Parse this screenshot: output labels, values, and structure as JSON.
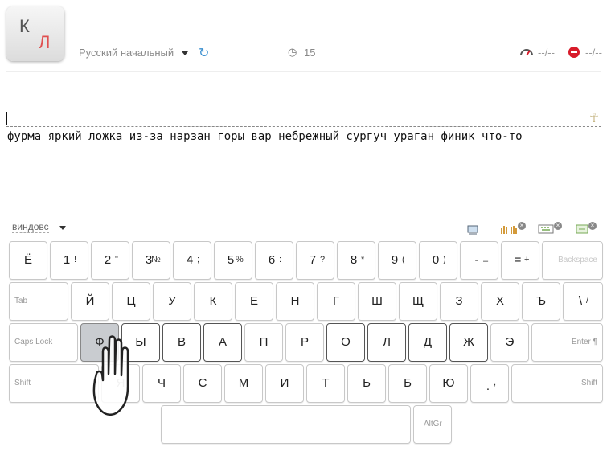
{
  "logo": {
    "letter1": "К",
    "letter2": "Л"
  },
  "header": {
    "course": "Русский начальный",
    "time_icon": "clock-icon",
    "time": "15",
    "speed": "--/--",
    "errors": "--/--",
    "accent": "#3a8fcf",
    "error_color": "#d81b2a"
  },
  "lesson_text": "фурма яркий ложка из-за нарзан горы вар небрежный сургуч ураган финик что-то",
  "keyboard": {
    "layout": "виндовс",
    "keys": [
      {
        "main": "Ё"
      },
      {
        "main": "1",
        "shift": "!"
      },
      {
        "main": "2",
        "shift": "\""
      },
      {
        "main": "3",
        "shift": "№"
      },
      {
        "main": "4",
        "shift": ";"
      },
      {
        "main": "5",
        "shift": "%"
      },
      {
        "main": "6",
        "shift": ":"
      },
      {
        "main": "7",
        "shift": "?"
      },
      {
        "main": "8",
        "shift": "*"
      },
      {
        "main": "9",
        "shift": "("
      },
      {
        "main": "0",
        "shift": ")"
      },
      {
        "main": "-",
        "shift": "–"
      },
      {
        "main": "=",
        "shift": "+"
      },
      {
        "fn": "Backspace"
      },
      {
        "fn": "Tab"
      },
      {
        "main": "Й"
      },
      {
        "main": "Ц"
      },
      {
        "main": "У"
      },
      {
        "main": "К"
      },
      {
        "main": "Е"
      },
      {
        "main": "Н"
      },
      {
        "main": "Г"
      },
      {
        "main": "Ш"
      },
      {
        "main": "Щ"
      },
      {
        "main": "З"
      },
      {
        "main": "Х"
      },
      {
        "main": "Ъ"
      },
      {
        "main": "\\",
        "shift": "/"
      },
      {
        "fn": "Caps Lock"
      },
      {
        "main": "Ф"
      },
      {
        "main": "Ы"
      },
      {
        "main": "В"
      },
      {
        "main": "А"
      },
      {
        "main": "П"
      },
      {
        "main": "Р"
      },
      {
        "main": "О"
      },
      {
        "main": "Л"
      },
      {
        "main": "Д"
      },
      {
        "main": "Ж"
      },
      {
        "main": "Э"
      },
      {
        "fn": "Enter ¶"
      },
      {
        "fn": "Shift"
      },
      {
        "main": "Я"
      },
      {
        "main": "Ч"
      },
      {
        "main": "С"
      },
      {
        "main": "М"
      },
      {
        "main": "И"
      },
      {
        "main": "Т"
      },
      {
        "main": "Ь"
      },
      {
        "main": "Б"
      },
      {
        "main": "Ю"
      },
      {
        "main": ".",
        "shift": ","
      },
      {
        "fn": "Shift"
      },
      {
        "main": ""
      },
      {
        "fn": "AltGr"
      }
    ]
  }
}
